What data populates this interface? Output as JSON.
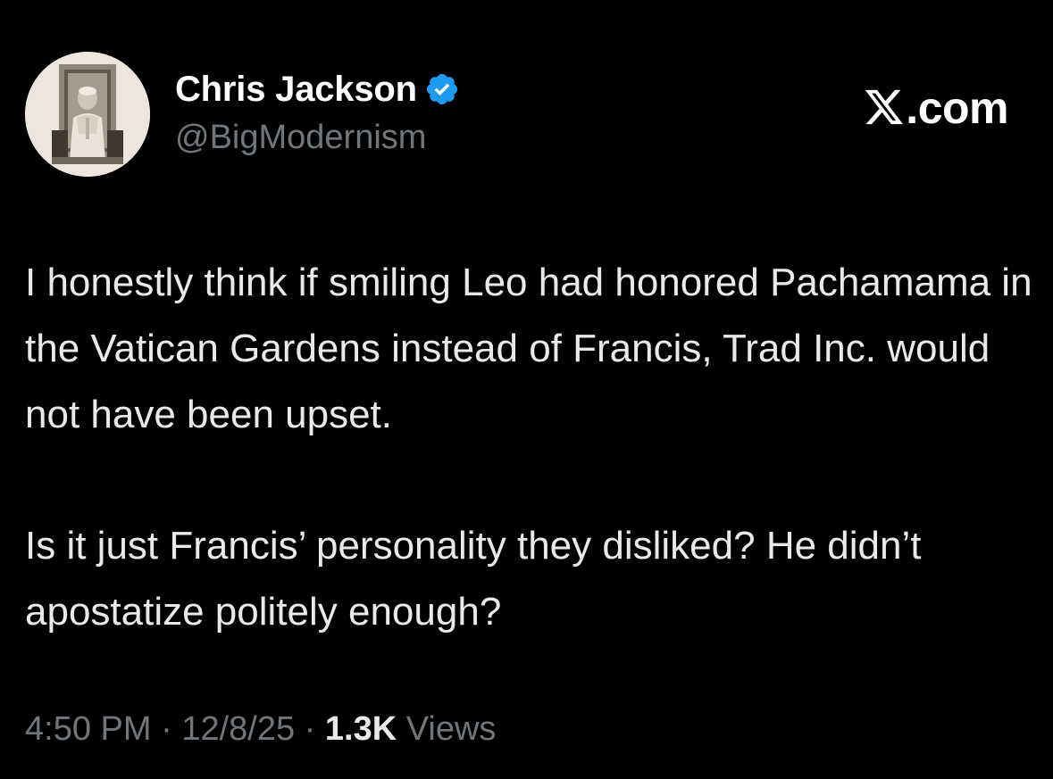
{
  "author": {
    "display_name": "Chris Jackson",
    "handle": "@BigModernism",
    "verified_icon": "verified-badge-icon",
    "verified_color": "#1d9bf0"
  },
  "brand": {
    "icon": "x-logo-icon",
    "text": ".com"
  },
  "post": {
    "paragraph_1": "I honestly think if smiling Leo had honored Pachamama in the Vatican Gardens instead of Francis, Trad Inc. would not have been upset.",
    "paragraph_2": "Is it just Francis’ personality they disliked? He didn’t apostatize politely enough?"
  },
  "meta": {
    "time": "4:50 PM",
    "separator": "·",
    "date": "12/8/25",
    "views_count": "1.3K",
    "views_label": "Views"
  },
  "colors": {
    "background": "#000000",
    "text_primary": "#e7e9ea",
    "text_secondary": "#71767b"
  }
}
